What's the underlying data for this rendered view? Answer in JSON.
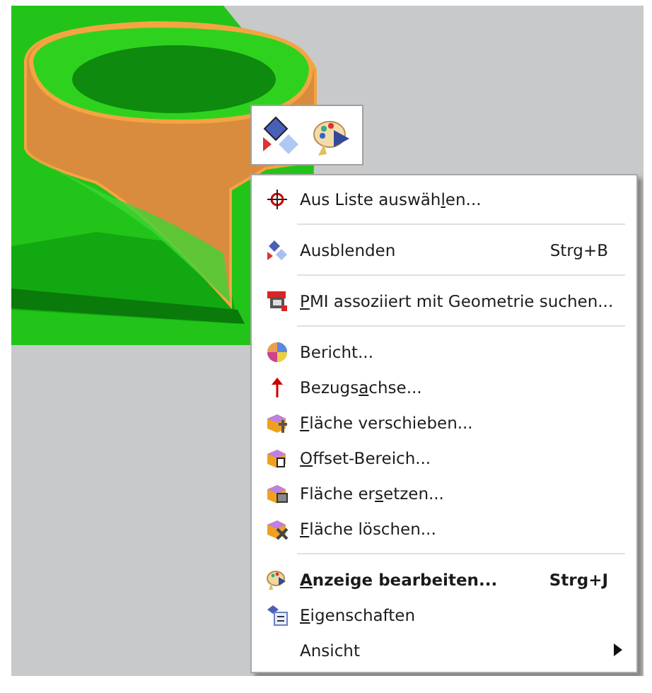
{
  "context_menu": {
    "items": [
      {
        "kind": "item",
        "before": "Aus Liste auswäh",
        "mnemonic": "l",
        "after": "en...",
        "default": false
      },
      {
        "kind": "separator"
      },
      {
        "kind": "item",
        "before": "Ausblenden",
        "shortcut": "Strg+B",
        "default": false
      },
      {
        "kind": "separator"
      },
      {
        "kind": "item",
        "mnemonic": "P",
        "after": "MI assoziiert mit Geometrie suchen...",
        "default": false
      },
      {
        "kind": "separator"
      },
      {
        "kind": "item",
        "before": "Bericht...",
        "default": false
      },
      {
        "kind": "item",
        "before": "Bezugs",
        "mnemonic": "a",
        "after": "chse...",
        "default": false
      },
      {
        "kind": "item",
        "mnemonic": "F",
        "after": "läche verschieben...",
        "default": false
      },
      {
        "kind": "item",
        "mnemonic": "O",
        "after": "ffset-Bereich...",
        "default": false
      },
      {
        "kind": "item",
        "before": "Fläche er",
        "mnemonic": "s",
        "after": "etzen...",
        "default": false
      },
      {
        "kind": "item",
        "mnemonic": "F",
        "after": "läche löschen...",
        "default": false
      },
      {
        "kind": "separator"
      },
      {
        "kind": "item",
        "mnemonic": "A",
        "after": "nzeige bearbeiten...",
        "shortcut": "Strg+J",
        "default": true
      },
      {
        "kind": "item",
        "mnemonic": "E",
        "after": "igenschaften",
        "default": false
      },
      {
        "kind": "submenu",
        "before": "Ansicht",
        "default": false
      }
    ]
  }
}
